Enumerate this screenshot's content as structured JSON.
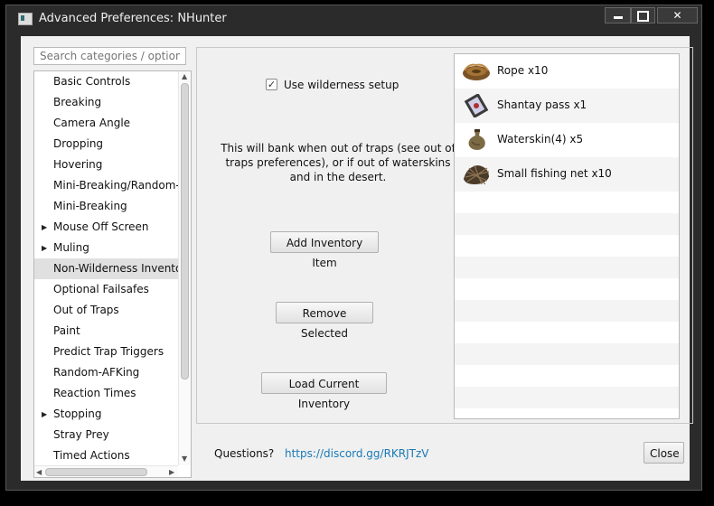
{
  "window": {
    "title": "Advanced Preferences: NHunter",
    "close_glyph": "✕"
  },
  "sidebar": {
    "search_placeholder": "Search categories / options",
    "items": [
      {
        "label": "Basic Controls",
        "has_children": false,
        "selected": false
      },
      {
        "label": "Breaking",
        "has_children": false,
        "selected": false
      },
      {
        "label": "Camera Angle",
        "has_children": false,
        "selected": false
      },
      {
        "label": "Dropping",
        "has_children": false,
        "selected": false
      },
      {
        "label": "Hovering",
        "has_children": false,
        "selected": false
      },
      {
        "label": "Mini-Breaking/Random-AF",
        "has_children": false,
        "selected": false
      },
      {
        "label": "Mini-Breaking",
        "has_children": false,
        "selected": false
      },
      {
        "label": "Mouse Off Screen",
        "has_children": true,
        "selected": false
      },
      {
        "label": "Muling",
        "has_children": true,
        "selected": false
      },
      {
        "label": "Non-Wilderness Inventory",
        "has_children": false,
        "selected": true
      },
      {
        "label": "Optional Failsafes",
        "has_children": false,
        "selected": false
      },
      {
        "label": "Out of Traps",
        "has_children": false,
        "selected": false
      },
      {
        "label": "Paint",
        "has_children": false,
        "selected": false
      },
      {
        "label": "Predict Trap Triggers",
        "has_children": false,
        "selected": false
      },
      {
        "label": "Random-AFKing",
        "has_children": false,
        "selected": false
      },
      {
        "label": "Reaction Times",
        "has_children": false,
        "selected": false
      },
      {
        "label": "Stopping",
        "has_children": true,
        "selected": false
      },
      {
        "label": "Stray Prey",
        "has_children": false,
        "selected": false
      },
      {
        "label": "Timed Actions",
        "has_children": false,
        "selected": false
      }
    ]
  },
  "main": {
    "use_wilderness_setup": {
      "label": "Use wilderness setup",
      "checked": true
    },
    "info_text": "This will bank when out of traps (see out of traps preferences), or if out of waterskins and in the desert.",
    "add_button": "Add Inventory Item",
    "remove_button": "Remove Selected",
    "load_button": "Load Current Inventory",
    "inventory": [
      {
        "label": "Rope x10",
        "icon": "rope-icon"
      },
      {
        "label": "Shantay pass x1",
        "icon": "shantay-pass-icon"
      },
      {
        "label": "Waterskin(4) x5",
        "icon": "waterskin-icon"
      },
      {
        "label": "Small fishing net x10",
        "icon": "fishing-net-icon"
      }
    ]
  },
  "footer": {
    "questions_label": "Questions?",
    "link_text": "https://discord.gg/RKRJTzV",
    "close_button": "Close"
  },
  "colors": {
    "window_frame": "#2b2b2b",
    "client_bg": "#f0f0f0",
    "link": "#1a7ab6",
    "selected_row": "#e0e0e0"
  }
}
